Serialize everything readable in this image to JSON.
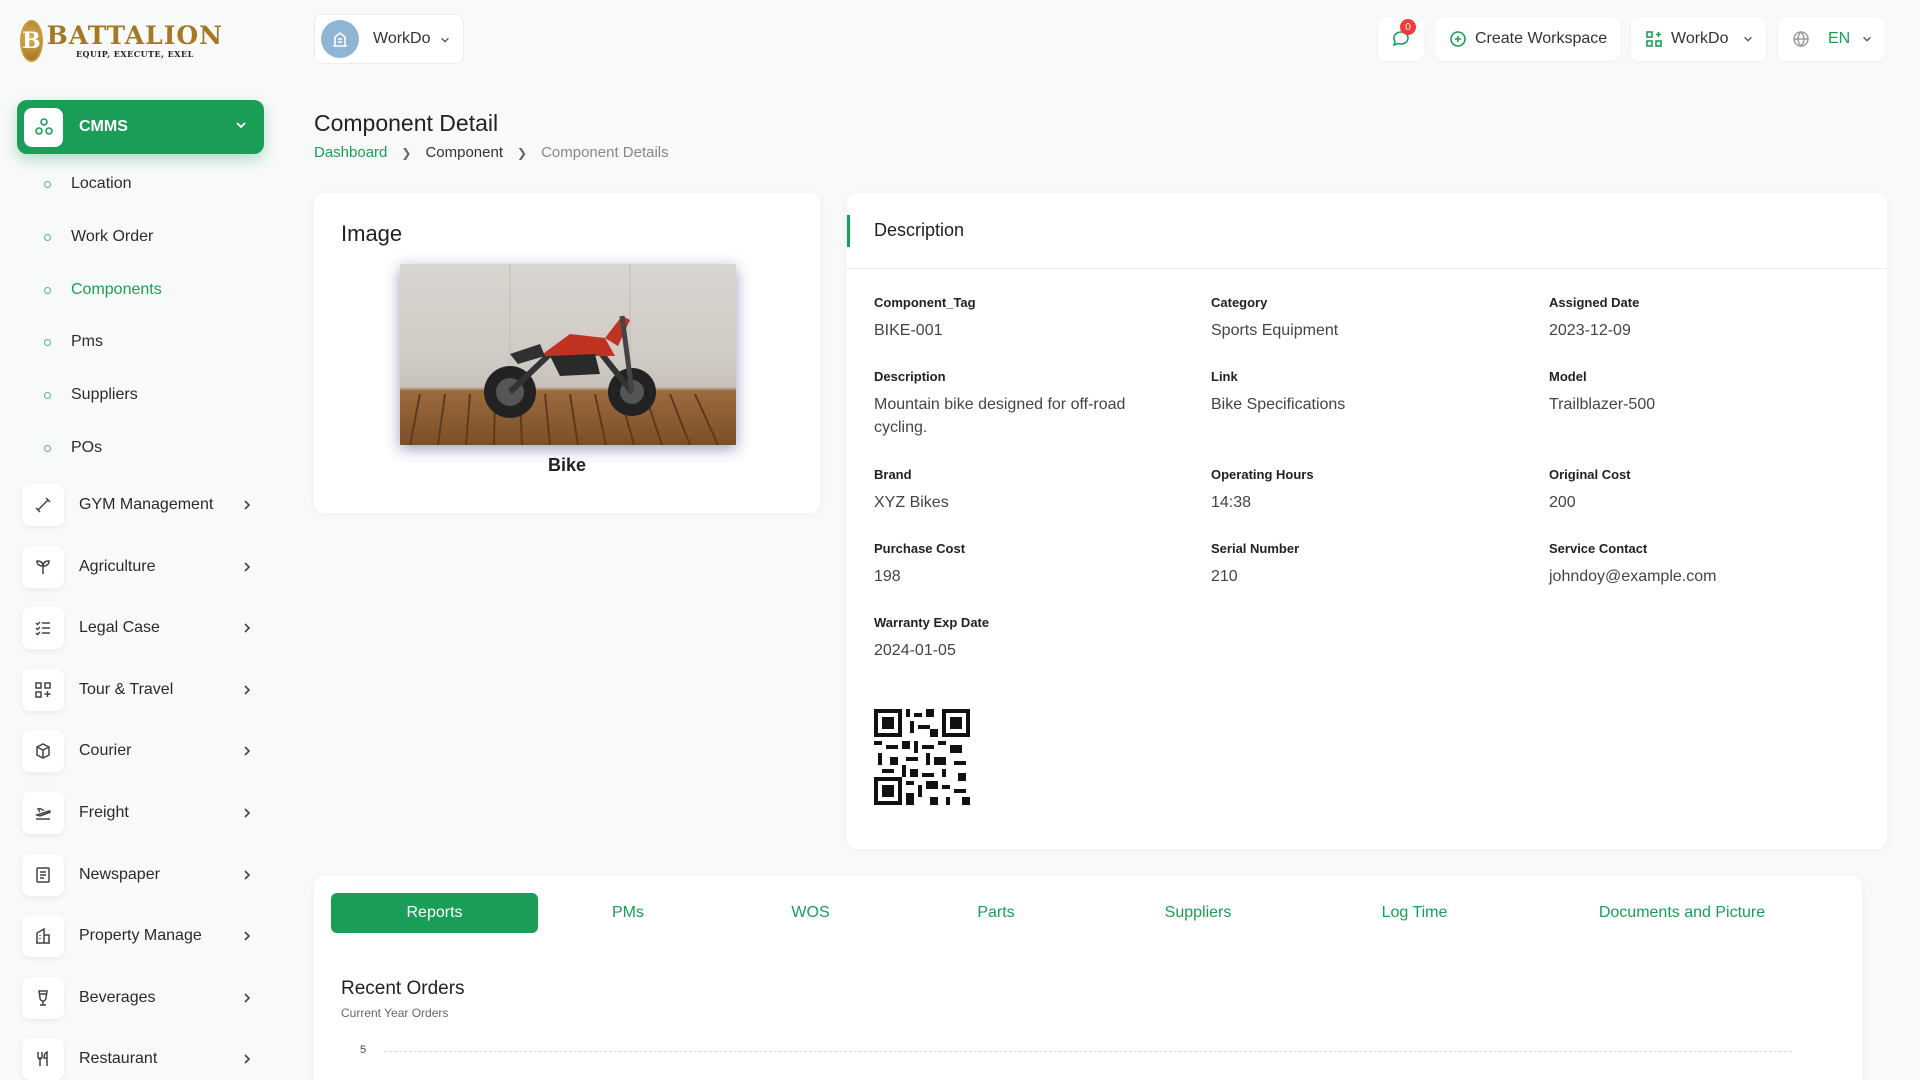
{
  "brand": {
    "logo_letter": "B",
    "logo_title": "BATTALION",
    "logo_tagline": "EQUIP, EXECUTE, EXEL",
    "accent_color": "#1a9e57"
  },
  "sidebar": {
    "active_module": {
      "label": "CMMS",
      "icon": "cmms-icon"
    },
    "sub_items": [
      {
        "label": "Location"
      },
      {
        "label": "Work Order"
      },
      {
        "label": "Components"
      },
      {
        "label": "Pms"
      },
      {
        "label": "Suppliers"
      },
      {
        "label": "POs"
      }
    ],
    "modules": [
      {
        "label": "GYM Management",
        "icon": "dumbbell-icon"
      },
      {
        "label": "Agriculture",
        "icon": "plant-icon"
      },
      {
        "label": "Legal Case",
        "icon": "checklist-icon"
      },
      {
        "label": "Tour & Travel",
        "icon": "grid-icon"
      },
      {
        "label": "Courier",
        "icon": "box-icon"
      },
      {
        "label": "Freight",
        "icon": "plane-icon"
      },
      {
        "label": "Newspaper",
        "icon": "newspaper-icon"
      },
      {
        "label": "Property Manage",
        "icon": "building-icon"
      },
      {
        "label": "Beverages",
        "icon": "glass-icon"
      },
      {
        "label": "Restaurant",
        "icon": "utensils-icon"
      }
    ]
  },
  "header": {
    "workspace": "WorkDo",
    "notifications": "0",
    "create_workspace": "Create Workspace",
    "workdo_menu": "WorkDo",
    "language": "EN"
  },
  "page": {
    "title": "Component Detail",
    "breadcrumb": [
      "Dashboard",
      "Component",
      "Component Details"
    ]
  },
  "image_card": {
    "heading": "Image",
    "caption": "Bike"
  },
  "description": {
    "heading": "Description",
    "fields": [
      {
        "key": "Component_Tag",
        "value": "BIKE-001"
      },
      {
        "key": "Category",
        "value": "Sports Equipment"
      },
      {
        "key": "Assigned Date",
        "value": "2023-12-09"
      },
      {
        "key": "Description",
        "value": "Mountain bike designed for off-road cycling."
      },
      {
        "key": "Link",
        "value": "Bike Specifications"
      },
      {
        "key": "Model",
        "value": "Trailblazer-500"
      },
      {
        "key": "Brand",
        "value": "XYZ Bikes"
      },
      {
        "key": "Operating Hours",
        "value": "14:38"
      },
      {
        "key": "Original Cost",
        "value": "200"
      },
      {
        "key": "Purchase Cost",
        "value": "198"
      },
      {
        "key": "Serial Number",
        "value": "210"
      },
      {
        "key": "Service Contact",
        "value": "johndoy@example.com"
      },
      {
        "key": "Warranty Exp Date",
        "value": "2024-01-05"
      }
    ]
  },
  "tabs": {
    "items": [
      "Reports",
      "PMs",
      "WOS",
      "Parts",
      "Suppliers",
      "Log Time",
      "Documents and Picture"
    ],
    "active": "Reports"
  },
  "chart": {
    "title": "Recent Orders",
    "subtitle": "Current Year Orders",
    "y_tick_top": "5"
  }
}
